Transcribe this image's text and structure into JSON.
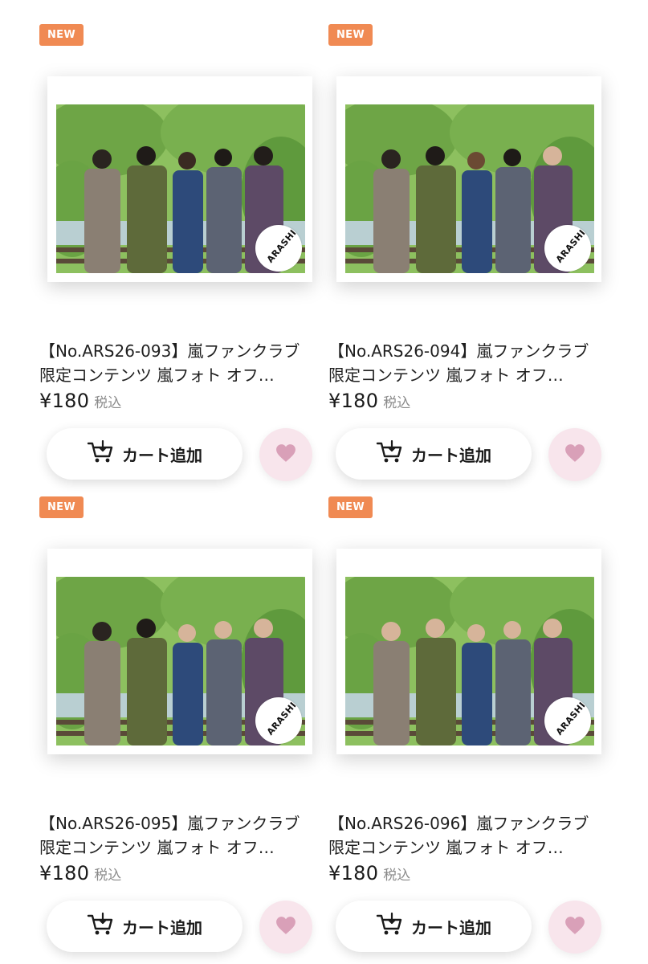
{
  "products": [
    {
      "badge": "NEW",
      "title": "【No.ARS26-093】嵐ファンクラブ限定コンテンツ 嵐フォト オフ…",
      "price": "¥180",
      "tax_label": "税込",
      "cart_label": "カート追加",
      "logo_text": "ARASHI"
    },
    {
      "badge": "NEW",
      "title": "【No.ARS26-094】嵐ファンクラブ限定コンテンツ 嵐フォト オフ…",
      "price": "¥180",
      "tax_label": "税込",
      "cart_label": "カート追加",
      "logo_text": "ARASHI"
    },
    {
      "badge": "NEW",
      "title": "【No.ARS26-095】嵐ファンクラブ限定コンテンツ 嵐フォト オフ…",
      "price": "¥180",
      "tax_label": "税込",
      "cart_label": "カート追加",
      "logo_text": "ARASHI"
    },
    {
      "badge": "NEW",
      "title": "【No.ARS26-096】嵐ファンクラブ限定コンテンツ 嵐フォト オフ…",
      "price": "¥180",
      "tax_label": "税込",
      "cart_label": "カート追加",
      "logo_text": "ARASHI"
    }
  ],
  "colors": {
    "badge": "#f08a53",
    "favorite_bg": "#f8e5ec",
    "favorite_heart": "#d9a0b8"
  },
  "icons": {
    "cart": "cart-add-icon",
    "favorite": "heart-icon"
  }
}
